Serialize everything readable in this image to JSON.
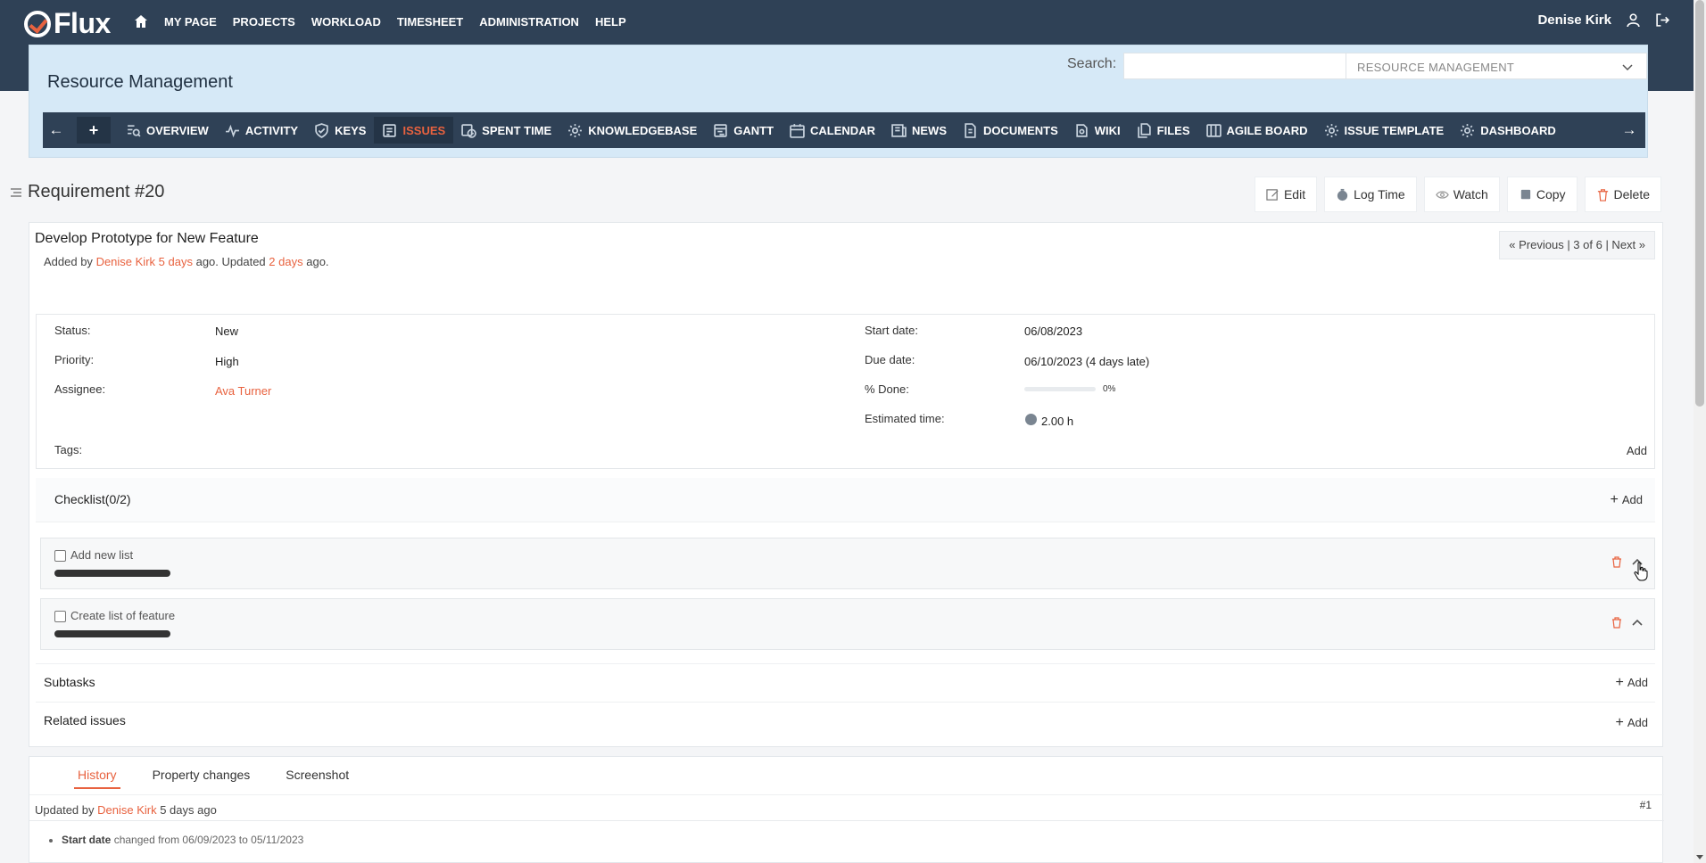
{
  "app": {
    "logo_text": "Flux"
  },
  "topnav": {
    "items": [
      "MY PAGE",
      "PROJECTS",
      "WORKLOAD",
      "TIMESHEET",
      "ADMINISTRATION",
      "HELP"
    ]
  },
  "user": {
    "name": "Denise Kirk"
  },
  "project": {
    "title": "Resource Management",
    "search_label": "Search:",
    "search_placeholder": "",
    "selected_project": "RESOURCE MANAGEMENT"
  },
  "tabs": [
    {
      "label": "OVERVIEW",
      "icon": "overview-icon"
    },
    {
      "label": "ACTIVITY",
      "icon": "activity-icon"
    },
    {
      "label": "KEYS",
      "icon": "shield-icon"
    },
    {
      "label": "ISSUES",
      "icon": "issues-icon",
      "active": true
    },
    {
      "label": "SPENT TIME",
      "icon": "time-icon"
    },
    {
      "label": "KNOWLEDGEBASE",
      "icon": "gear-icon"
    },
    {
      "label": "GANTT",
      "icon": "gantt-icon"
    },
    {
      "label": "CALENDAR",
      "icon": "calendar-icon"
    },
    {
      "label": "NEWS",
      "icon": "news-icon"
    },
    {
      "label": "DOCUMENTS",
      "icon": "document-icon"
    },
    {
      "label": "WIKI",
      "icon": "wiki-icon"
    },
    {
      "label": "FILES",
      "icon": "files-icon"
    },
    {
      "label": "AGILE BOARD",
      "icon": "board-icon"
    },
    {
      "label": "ISSUE TEMPLATE",
      "icon": "gear-icon"
    },
    {
      "label": "DASHBOARD",
      "icon": "gear-icon"
    }
  ],
  "issue": {
    "heading": "Requirement #20",
    "subject": "Develop Prototype for New Feature",
    "meta": {
      "added_by_prefix": "Added by",
      "author": "Denise Kirk",
      "added_ago": "5 days",
      "updated_prefix": "ago. Updated",
      "updated_ago": "2 days",
      "suffix": "ago."
    },
    "pager": "« Previous | 3 of 6 | Next »",
    "actions": [
      "Edit",
      "Log Time",
      "Watch",
      "Copy",
      "Delete"
    ],
    "attributes": {
      "status_label": "Status:",
      "status": "New",
      "priority_label": "Priority:",
      "priority": "High",
      "assignee_label": "Assignee:",
      "assignee": "Ava Turner",
      "start_label": "Start date:",
      "start": "06/08/2023",
      "due_label": "Due date:",
      "due": "06/10/2023 (4 days late)",
      "done_label": "% Done:",
      "done": "0%",
      "done_value": 0,
      "est_label": "Estimated time:",
      "est": "2.00 h",
      "tags_label": "Tags:",
      "tags_add": "Add"
    },
    "checklist": {
      "title": "Checklist(0/2)",
      "add": "Add",
      "items": [
        {
          "label": "Add new list",
          "checked": false
        },
        {
          "label": "Create list of feature",
          "checked": false
        }
      ]
    },
    "subtasks": {
      "title": "Subtasks",
      "add": "Add"
    },
    "related": {
      "title": "Related issues",
      "add": "Add"
    }
  },
  "history": {
    "tabs": [
      "History",
      "Property changes",
      "Screenshot"
    ],
    "updated_prefix": "Updated by",
    "author": "Denise Kirk",
    "ago": "5 days ago",
    "number": "#1",
    "change_field": "Start date",
    "change_text": "changed from 06/09/2023 to 05/11/2023"
  },
  "colors": {
    "accent": "#e8623f",
    "nav_bg": "#2f4156",
    "panel_bg": "#d6e9f7"
  }
}
